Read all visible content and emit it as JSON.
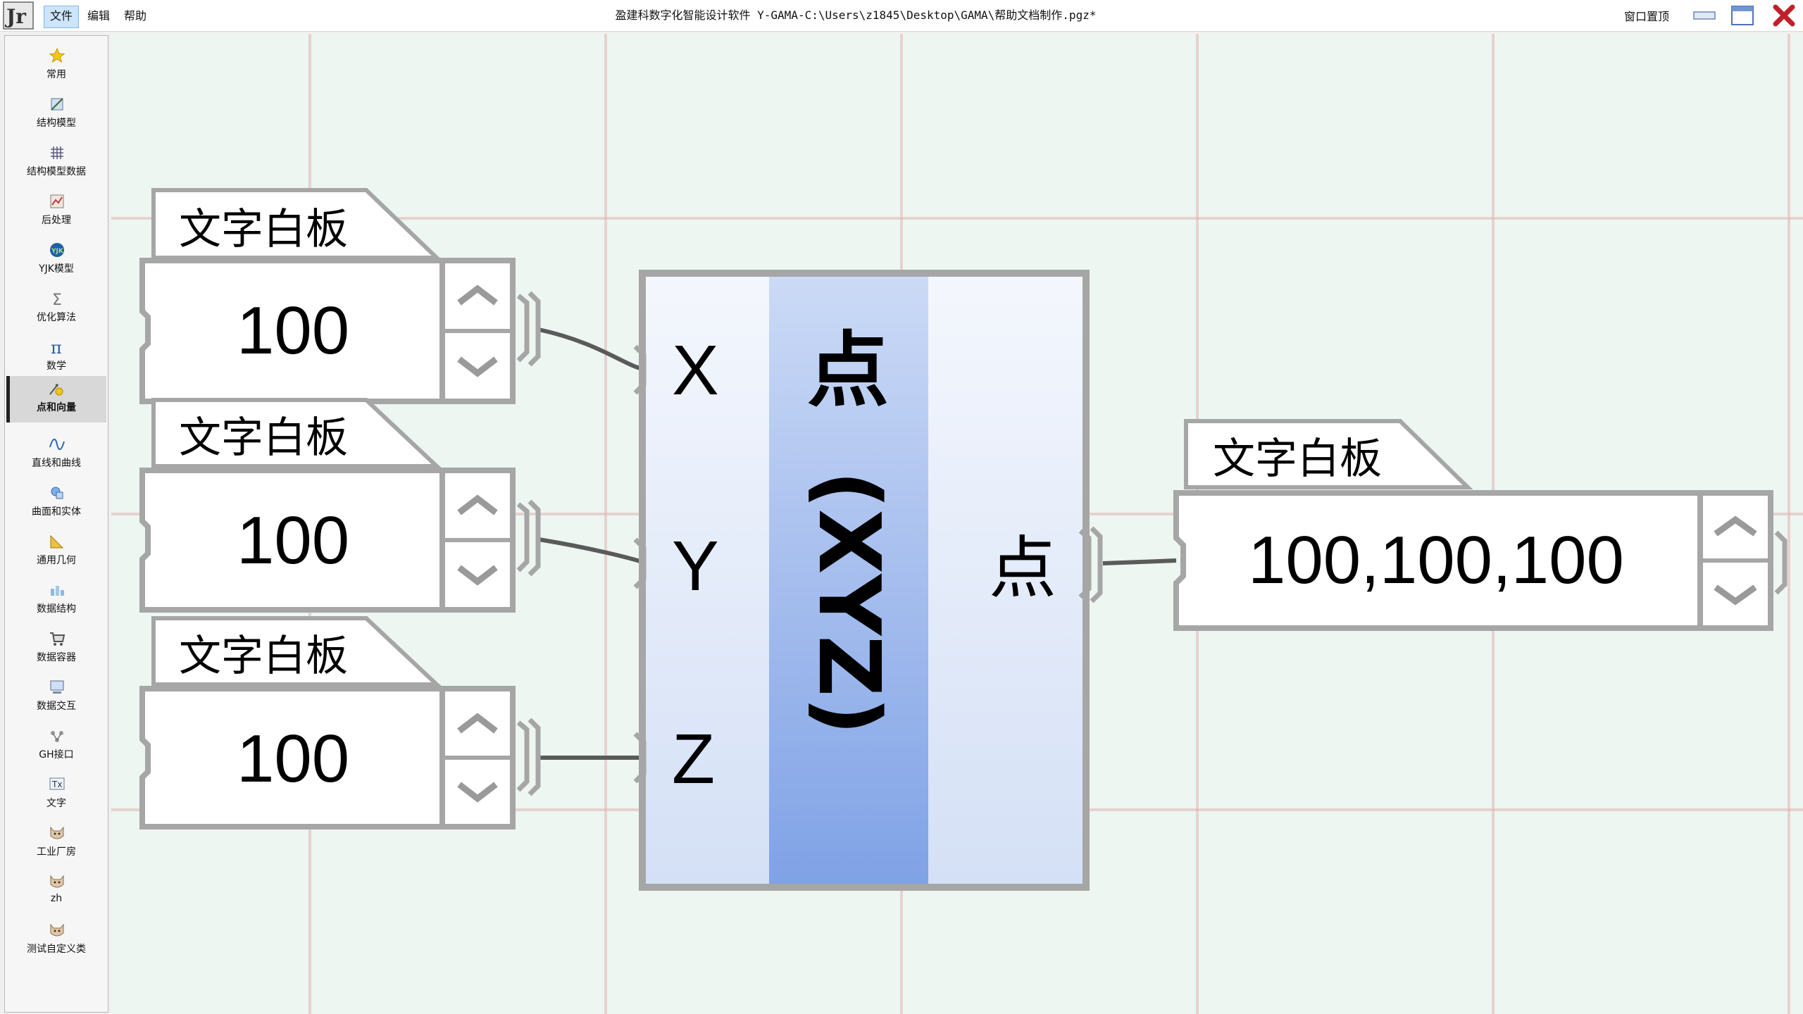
{
  "titlebar": {
    "logo_icon": "jr-logo-icon",
    "menus": [
      "文件",
      "编辑",
      "帮助"
    ],
    "title": "盈建科数字化智能设计软件 Y-GAMA-C:\\Users\\z1845\\Desktop\\GAMA\\帮助文档制作.pgz*",
    "window_reset": "窗口置顶",
    "controls": [
      "minimize-icon",
      "maximize-icon",
      "close-icon"
    ]
  },
  "sidebar": {
    "items": [
      {
        "label": "常用",
        "icon": "star-icon",
        "active": false
      },
      {
        "label": "结构模型",
        "icon": "structure-model-icon",
        "active": false
      },
      {
        "label": "结构模型数据",
        "icon": "grid-icon",
        "active": false
      },
      {
        "label": "后处理",
        "icon": "postprocess-icon",
        "active": false
      },
      {
        "label": "YJK模型",
        "icon": "yjk-icon",
        "active": false
      },
      {
        "label": "优化算法",
        "icon": "sigma-icon",
        "active": false
      },
      {
        "label": "数学",
        "icon": "pi-icon",
        "active": false
      },
      {
        "label": "点和向量",
        "icon": "point-vector-icon",
        "active": true
      },
      {
        "label": "直线和曲线",
        "icon": "curve-icon",
        "active": false
      },
      {
        "label": "曲面和实体",
        "icon": "surface-icon",
        "active": false
      },
      {
        "label": "通用几何",
        "icon": "triangle-ruler-icon",
        "active": false
      },
      {
        "label": "数据结构",
        "icon": "data-structure-icon",
        "active": false
      },
      {
        "label": "数据容器",
        "icon": "cart-icon",
        "active": false
      },
      {
        "label": "数据交互",
        "icon": "computer-icon",
        "active": false
      },
      {
        "label": "GH接口",
        "icon": "gh-interface-icon",
        "active": false
      },
      {
        "label": "文字",
        "icon": "text-icon",
        "active": false
      },
      {
        "label": "工业厂房",
        "icon": "cat-icon",
        "active": false
      },
      {
        "label": "zh",
        "icon": "cat-icon",
        "active": false
      },
      {
        "label": "测试自定义类",
        "icon": "cat-icon",
        "active": false
      }
    ]
  },
  "canvas": {
    "inputs": [
      {
        "tab": "文字白板",
        "value": "100"
      },
      {
        "tab": "文字白板",
        "value": "100"
      },
      {
        "tab": "文字白板",
        "value": "100"
      }
    ],
    "point_component": {
      "inputs": [
        "X",
        "Y",
        "Z"
      ],
      "name": "点",
      "subtitle": "(XYZ)",
      "output": "点"
    },
    "output_panel": {
      "tab": "文字白板",
      "value": "100,100,100"
    },
    "colors": {
      "canvas_bg": "#edf6f1",
      "grid": "#e0b4b4",
      "component_border": "#a6a6a6",
      "component_center": "#8aa9e9",
      "wire": "#5a5a5a"
    }
  }
}
